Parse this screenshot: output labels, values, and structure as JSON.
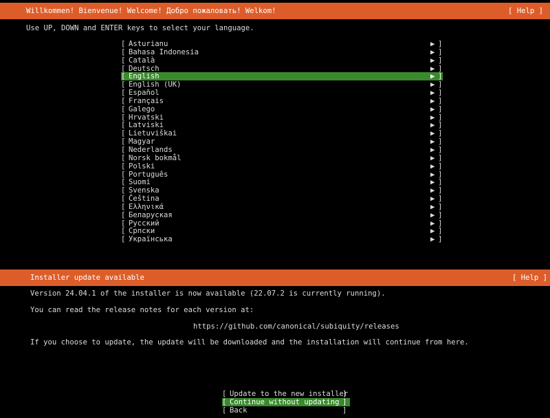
{
  "header": {
    "title": "Willkommen! Bienvenue! Welcome! Добро пожаловать! Welkom!",
    "help": "[ Help ]"
  },
  "instruction": "Use UP, DOWN and ENTER keys to select your language.",
  "languages": [
    {
      "name": "Asturianu"
    },
    {
      "name": "Bahasa Indonesia"
    },
    {
      "name": "Català"
    },
    {
      "name": "Deutsch"
    },
    {
      "name": "English",
      "selected": true
    },
    {
      "name": "English (UK)"
    },
    {
      "name": "Español"
    },
    {
      "name": "Français"
    },
    {
      "name": "Galego"
    },
    {
      "name": "Hrvatski"
    },
    {
      "name": "Latviski"
    },
    {
      "name": "Lietuviškai"
    },
    {
      "name": "Magyar"
    },
    {
      "name": "Nederlands"
    },
    {
      "name": "Norsk bokmål"
    },
    {
      "name": "Polski"
    },
    {
      "name": "Português"
    },
    {
      "name": "Suomi"
    },
    {
      "name": "Svenska"
    },
    {
      "name": "Čeština"
    },
    {
      "name": "Ελληνικά"
    },
    {
      "name": "Беларуская"
    },
    {
      "name": "Русский"
    },
    {
      "name": "Српски"
    },
    {
      "name": "Українська"
    }
  ],
  "list_glyphs": {
    "left": "[",
    "right": "]",
    "arrow": "▶"
  },
  "update_dialog": {
    "title": "Installer update available",
    "help": "[ Help ]",
    "version_text": "Version 24.04.1 of the installer is now available (22.07.2 is currently running).",
    "notes_text": "You can read the release notes for each version at:",
    "url": "https://github.com/canonical/subiquity/releases",
    "choice_text": "If you choose to update, the update will be downloaded and the installation will continue from here."
  },
  "buttons": [
    {
      "label": "Update to the new installer"
    },
    {
      "label": "Continue without updating",
      "selected": true
    },
    {
      "label": "Back"
    }
  ],
  "colors": {
    "header_bg": "#dd5d2a",
    "selection_bg": "#3a8a2d",
    "background": "#000000",
    "text": "#dcdcdc"
  }
}
